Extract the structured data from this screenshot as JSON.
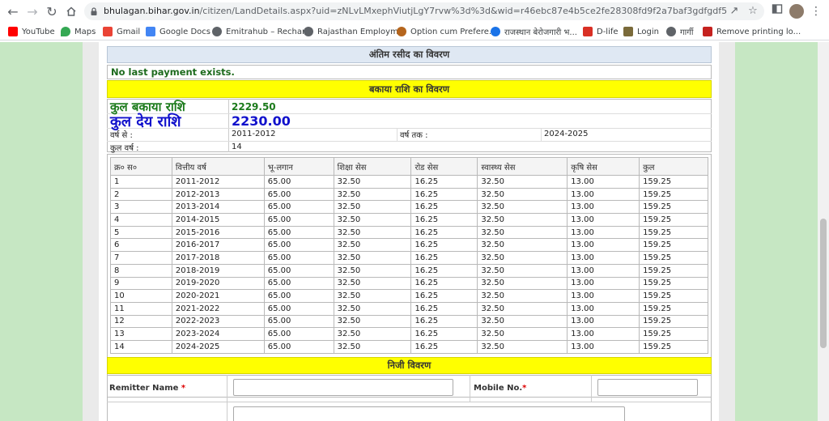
{
  "browser": {
    "url_host": "bhulagan.bihar.gov.in",
    "url_rest": "/citizen/LandDetails.aspx?uid=zNLvLMxephViutjLgY7rvw%3d%3d&wid=r46ebc87e4b5ce2fe28308fd9f2a7baf3gdfgdf543g&did=1cQnS8RYeQ...",
    "bookmarks": [
      "YouTube",
      "Maps",
      "Gmail",
      "Google Docs",
      "Emitrahub – Rechar...",
      "Rajasthan Employm...",
      "Option cum Prefere...",
      "राजस्थान बेरोजगारी भ...",
      "D-life",
      "Login",
      "गार्गी",
      "Remove printing lo..."
    ]
  },
  "last_receipt": {
    "heading": "अंतिम रसीद का विवरण",
    "message": "No last payment exists."
  },
  "dues": {
    "heading": "बकाया राशि का विवरण",
    "total_due_label": "कुल बकाया राशि",
    "total_due_value": "2229.50",
    "total_payable_label": "कुल देय राशि",
    "total_payable_value": "2230.00",
    "from_year_label": "वर्ष से :",
    "from_year_value": "2011-2012",
    "to_year_label": "वर्ष तक :",
    "to_year_value": "2024-2025",
    "total_years_label": "कुल वर्ष :",
    "total_years_value": "14",
    "columns": [
      "क्र० स०",
      "वित्तीय वर्ष",
      "भू-लगान",
      "शिक्षा सेस",
      "रोड सेस",
      "स्वास्थ्य सेस",
      "कृषि सेस",
      "कुल"
    ],
    "rows": [
      [
        "1",
        "2011-2012",
        "65.00",
        "32.50",
        "16.25",
        "32.50",
        "13.00",
        "159.25"
      ],
      [
        "2",
        "2012-2013",
        "65.00",
        "32.50",
        "16.25",
        "32.50",
        "13.00",
        "159.25"
      ],
      [
        "3",
        "2013-2014",
        "65.00",
        "32.50",
        "16.25",
        "32.50",
        "13.00",
        "159.25"
      ],
      [
        "4",
        "2014-2015",
        "65.00",
        "32.50",
        "16.25",
        "32.50",
        "13.00",
        "159.25"
      ],
      [
        "5",
        "2015-2016",
        "65.00",
        "32.50",
        "16.25",
        "32.50",
        "13.00",
        "159.25"
      ],
      [
        "6",
        "2016-2017",
        "65.00",
        "32.50",
        "16.25",
        "32.50",
        "13.00",
        "159.25"
      ],
      [
        "7",
        "2017-2018",
        "65.00",
        "32.50",
        "16.25",
        "32.50",
        "13.00",
        "159.25"
      ],
      [
        "8",
        "2018-2019",
        "65.00",
        "32.50",
        "16.25",
        "32.50",
        "13.00",
        "159.25"
      ],
      [
        "9",
        "2019-2020",
        "65.00",
        "32.50",
        "16.25",
        "32.50",
        "13.00",
        "159.25"
      ],
      [
        "10",
        "2020-2021",
        "65.00",
        "32.50",
        "16.25",
        "32.50",
        "13.00",
        "159.25"
      ],
      [
        "11",
        "2021-2022",
        "65.00",
        "32.50",
        "16.25",
        "32.50",
        "13.00",
        "159.25"
      ],
      [
        "12",
        "2022-2023",
        "65.00",
        "32.50",
        "16.25",
        "32.50",
        "13.00",
        "159.25"
      ],
      [
        "13",
        "2023-2024",
        "65.00",
        "32.50",
        "16.25",
        "32.50",
        "13.00",
        "159.25"
      ],
      [
        "14",
        "2024-2025",
        "65.00",
        "32.50",
        "16.25",
        "32.50",
        "13.00",
        "159.25"
      ]
    ]
  },
  "personal": {
    "heading": "निजी विवरण",
    "remitter_label": "Remitter Name",
    "remitter_value": "",
    "mobile_label": "Mobile No.",
    "mobile_value": "",
    "required_mark": "*"
  },
  "colors": {
    "highlight": "#ffff00",
    "section_blue": "#dfe8f3",
    "page_bg": "#c6e7c3",
    "due_green": "#1b7a1b",
    "payable_blue": "#1111cc",
    "message_green": "#1d6b1d",
    "required_red": "#dd0000"
  }
}
